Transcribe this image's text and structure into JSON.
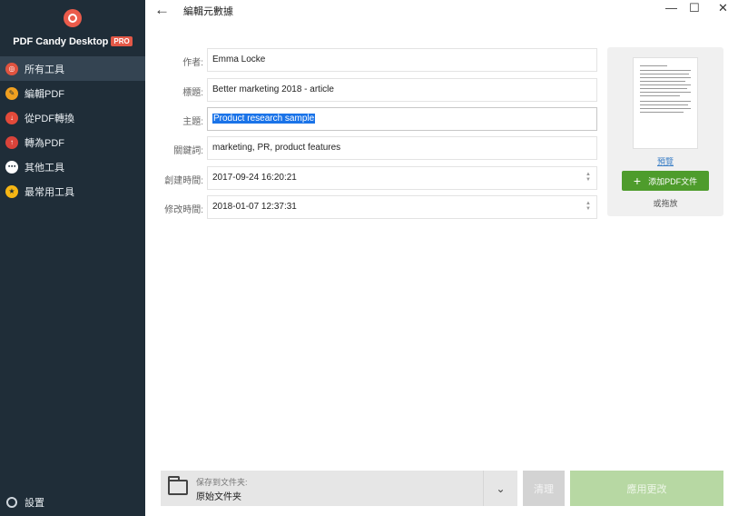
{
  "app": {
    "brand": "PDF Candy Desktop",
    "badge": "PRO"
  },
  "sidebar": {
    "items": [
      {
        "label": "所有工具",
        "icon": "target-icon",
        "active": true
      },
      {
        "label": "編輯PDF",
        "icon": "pencil-icon"
      },
      {
        "label": "從PDF轉換",
        "icon": "arrow-down-icon"
      },
      {
        "label": "轉為PDF",
        "icon": "arrow-up-icon"
      },
      {
        "label": "其他工具",
        "icon": "more-icon"
      },
      {
        "label": "最常用工具",
        "icon": "star-icon"
      }
    ],
    "settings_label": "設置"
  },
  "header": {
    "title": "編輯元數據",
    "back_glyph": "←",
    "minimize_glyph": "—",
    "maximize_glyph": "☐",
    "close_glyph": "✕"
  },
  "form": {
    "author_label": "作者:",
    "author_value": "Emma Locke",
    "title_label": "標題:",
    "title_value": "Better marketing 2018 - article",
    "subject_label": "主題:",
    "subject_value": "Product research sample",
    "keywords_label": "關鍵詞:",
    "keywords_value": "marketing, PR, product features",
    "created_label": "創建時間:",
    "created_value": "2017-09-24 16:20:21",
    "modified_label": "修改時間:",
    "modified_value": "2018-01-07 12:37:31"
  },
  "preview": {
    "link_label": "預覽",
    "add_button_label": "添加PDF文件",
    "drag_label": "或拖放"
  },
  "footer": {
    "save_label": "保存到文件夹:",
    "save_value": "原始文件夹",
    "clear_label": "清理",
    "apply_label": "應用更改"
  },
  "colors": {
    "sidebar_bg": "#1f2d38",
    "accent_green": "#4e9c2c",
    "selection_blue": "#1a73e8"
  }
}
